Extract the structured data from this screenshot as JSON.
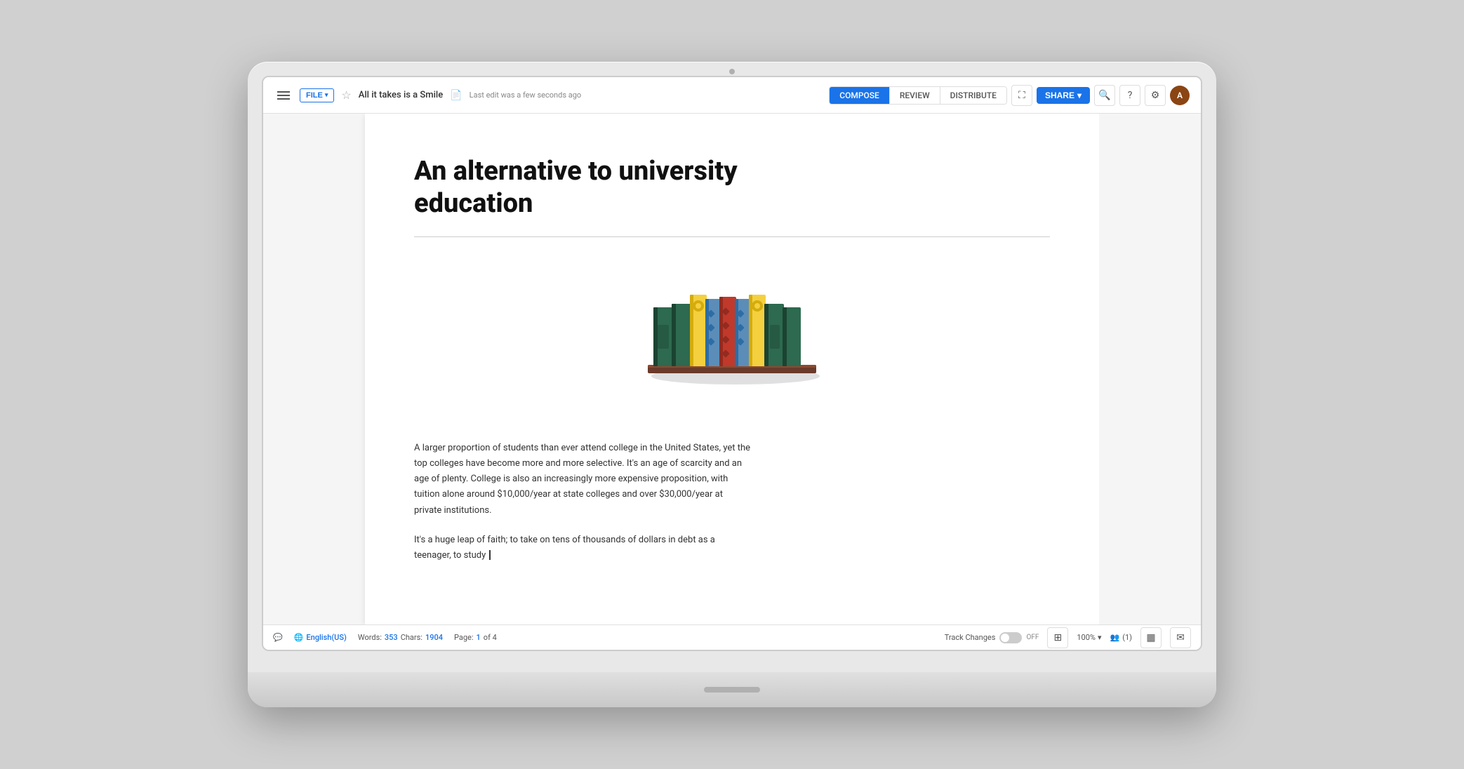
{
  "toolbar": {
    "file_label": "FILE",
    "file_chevron": "▾",
    "doc_title": "All it takes is a Smile",
    "last_edit": "Last edit was a few seconds ago",
    "tabs": [
      {
        "id": "compose",
        "label": "COMPOSE",
        "active": true
      },
      {
        "id": "review",
        "label": "REVIEW",
        "active": false
      },
      {
        "id": "distribute",
        "label": "DISTRIBUTE",
        "active": false
      }
    ],
    "share_label": "SHARE",
    "share_chevron": "▾"
  },
  "document": {
    "heading": "An alternative to university education",
    "paragraph1": "A larger proportion of students than ever attend college in the United States, yet the top colleges have become more and more selective. It's an age of scarcity and an age of plenty. College is also an increasingly more expensive proposition, with tuition alone around $10,000/year at state colleges and over $30,000/year at private institutions.",
    "paragraph2": "It's a huge leap of faith; to take on tens of thousands of dollars in debt as a teenager, to study"
  },
  "status_bar": {
    "comment_icon": "💬",
    "language": "English(US)",
    "words_label": "Words:",
    "words_count": "353",
    "chars_label": "Chars:",
    "chars_count": "1904",
    "page_label": "Page:",
    "page_current": "1",
    "page_of": "of 4",
    "track_changes": "Track Changes",
    "track_state": "OFF",
    "zoom": "100%",
    "collaborators": "(1)"
  }
}
